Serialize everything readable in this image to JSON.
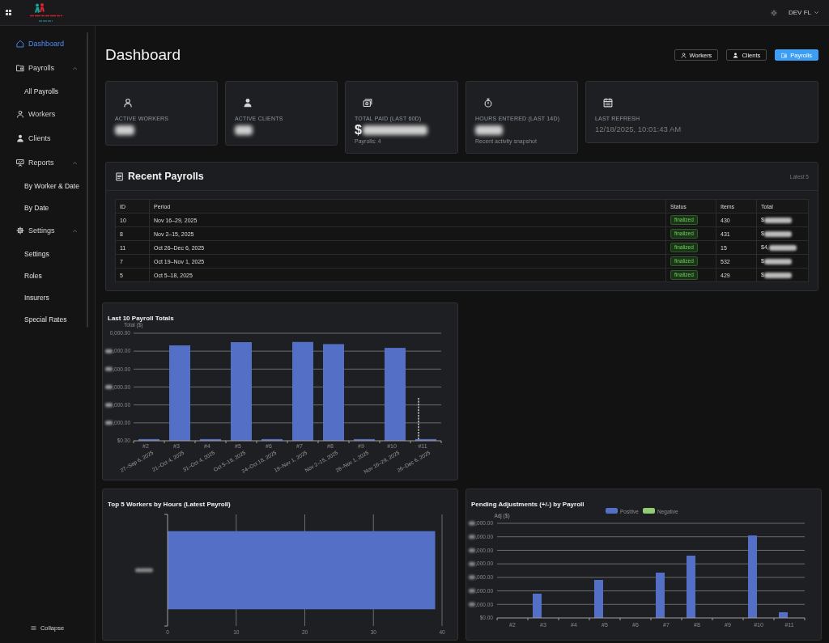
{
  "topbar": {
    "user": "DEV FL"
  },
  "sidebar": {
    "items": [
      {
        "label": "Dashboard",
        "selected": true
      },
      {
        "label": "Payrolls",
        "selected": false,
        "expanded": true,
        "children": [
          {
            "label": "All Payrolls",
            "selected": false
          }
        ]
      },
      {
        "label": "Workers",
        "selected": false
      },
      {
        "label": "Clients",
        "selected": false
      },
      {
        "label": "Reports",
        "selected": false,
        "expanded": true,
        "children": [
          {
            "label": "By Worker & Date",
            "selected": false
          },
          {
            "label": "By Date",
            "selected": false
          }
        ]
      },
      {
        "label": "Settings",
        "selected": false,
        "expanded": true,
        "children": [
          {
            "label": "Settings",
            "selected": false
          },
          {
            "label": "Roles",
            "selected": false
          },
          {
            "label": "Insurers",
            "selected": false
          },
          {
            "label": "Special Rates",
            "selected": false
          }
        ]
      }
    ],
    "collapse": "Collapse"
  },
  "page": {
    "title": "Dashboard",
    "buttons": [
      {
        "label": "Workers",
        "kind": "outline"
      },
      {
        "label": "Clients",
        "kind": "outline"
      },
      {
        "label": "Payrolls",
        "kind": "primary"
      }
    ]
  },
  "stats": [
    {
      "kind": "metric",
      "label": "ACTIVE WORKERS",
      "value_redacted": true
    },
    {
      "kind": "metric",
      "label": "ACTIVE CLIENTS",
      "value_redacted": true
    },
    {
      "kind": "metric",
      "label": "TOTAL PAID (LAST 60D)",
      "value": "$",
      "value_redacted": true,
      "note": "Payrolls: 4"
    },
    {
      "kind": "metric",
      "label": "HOURS ENTERED (LAST 14D)",
      "value_redacted": true,
      "note": "Recent activity snapshot"
    },
    {
      "kind": "timestamp",
      "label": "LAST REFRESH",
      "value": "12/18/2025, 10:01:43 AM",
      "value_redacted": false
    }
  ],
  "recent_payrolls": {
    "title": "Recent Payrolls",
    "caption": "Latest 5",
    "columns": [
      "ID",
      "Period",
      "Status",
      "Items",
      "Total"
    ],
    "rows": [
      {
        "id": "10",
        "period": "Nov 16–29, 2025",
        "status": "finalized",
        "items": "430",
        "total": "$",
        "total_redacted": true
      },
      {
        "id": "8",
        "period": "Nov 2–15, 2025",
        "status": "finalized",
        "items": "431",
        "total": "$",
        "total_redacted": true
      },
      {
        "id": "11",
        "period": "Oct 26–Dec 6, 2025",
        "status": "finalized",
        "items": "15",
        "total": "$4,",
        "total_redacted": true
      },
      {
        "id": "7",
        "period": "Oct 19–Nov 1, 2025",
        "status": "finalized",
        "items": "532",
        "total": "$",
        "total_redacted": true
      },
      {
        "id": "5",
        "period": "Oct 5–18, 2025",
        "status": "finalized",
        "items": "429",
        "total": "$",
        "total_redacted": true
      }
    ]
  },
  "payroll_totals_chart": {
    "title": "Last 10 Payroll Totals",
    "ylabel": "Total ($)",
    "y_ticks": [
      {
        "label": "0,000.00",
        "redacted": false
      },
      {
        "label": ",000.00",
        "redacted": true
      },
      {
        "label": ",000.00",
        "redacted": true
      },
      {
        "label": ",000.00",
        "redacted": true
      },
      {
        "label": ",000.00",
        "redacted": true
      },
      {
        "label": ",000.00",
        "redacted": true
      },
      {
        "label": "$0.00",
        "redacted": false
      }
    ],
    "categories": [
      {
        "number": "#2",
        "period": "27–Sep 6, 2025",
        "hovered": false
      },
      {
        "number": "#3",
        "period": "21–Oct 4, 2025",
        "hovered": false
      },
      {
        "number": "#4",
        "period": "31–Oct 4, 2025",
        "hovered": false
      },
      {
        "number": "#5",
        "period": "Oct 5–18, 2025",
        "hovered": false
      },
      {
        "number": "#6",
        "period": "24–Oct 18, 2025",
        "hovered": false
      },
      {
        "number": "#7",
        "period": "19–Nov 1, 2025",
        "hovered": false
      },
      {
        "number": "#8",
        "period": "Nov 2–15, 2025",
        "hovered": false
      },
      {
        "number": "#9",
        "period": "28–Nov 1, 2025",
        "hovered": false
      },
      {
        "number": "#10",
        "period": "Nov 16–29, 2025",
        "hovered": false
      },
      {
        "number": "#11",
        "period": "26–Dec 6, 2025",
        "hovered": true
      }
    ]
  },
  "workers_hours_chart": {
    "labels_redacted": true,
    "chart_data": {
      "type": "bar",
      "orientation": "horizontal",
      "title": "Top 5 Workers by Hours (Latest Payroll)",
      "values": [
        39
      ],
      "xlim": [
        0,
        40
      ],
      "xticks": [
        0,
        10,
        20,
        30,
        40
      ],
      "grid": true
    }
  },
  "adjustments_chart": {
    "title": "Pending Adjustments (+/-) by Payroll",
    "legend": [
      {
        "label": "Positive",
        "color": "#5470c6"
      },
      {
        "label": "Negative",
        "color": "#91cc75"
      }
    ],
    "ylabel": "Adj ($)",
    "y_ticks": [
      {
        "label": ",000.00",
        "redacted": true
      },
      {
        "label": ",000.00",
        "redacted": true
      },
      {
        "label": ",000.00",
        "redacted": true
      },
      {
        "label": ",000.00",
        "redacted": true
      },
      {
        "label": ",000.00",
        "redacted": true
      },
      {
        "label": ",000.00",
        "redacted": true
      },
      {
        "label": ",000.00",
        "redacted": true
      },
      {
        "label": "$0.00",
        "redacted": false
      }
    ],
    "categories": [
      "#2",
      "#3",
      "#4",
      "#5",
      "#6",
      "#7",
      "#8",
      "#9",
      "#10",
      "#11"
    ]
  }
}
